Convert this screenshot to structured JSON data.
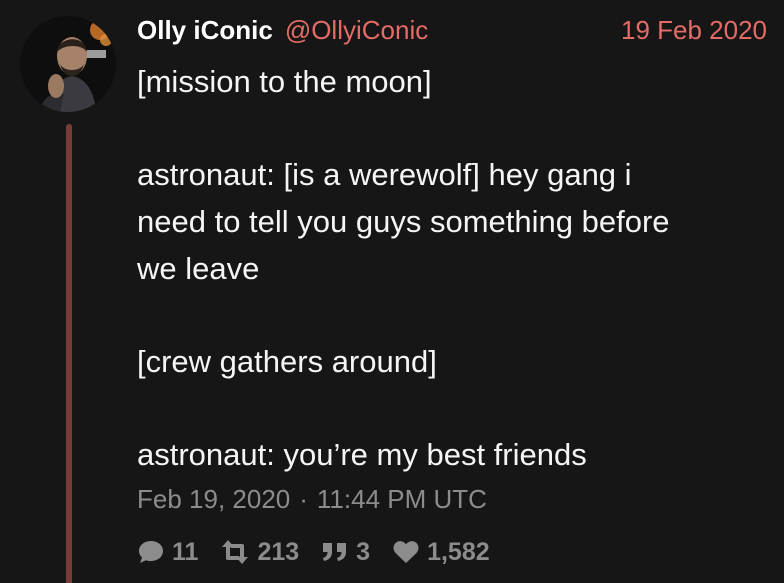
{
  "tweet": {
    "display_name": "Olly iConic",
    "handle": "@OllyiConic",
    "date": "19 Feb 2020",
    "lines": [
      "[mission to the moon]",
      "",
      "astronaut: [is a werewolf] hey gang i",
      "need to tell you guys something before",
      "we leave",
      "",
      "[crew gathers around]",
      "",
      "astronaut: you’re my best friends"
    ],
    "timestamp_date": "Feb 19, 2020",
    "timestamp_separator": "·",
    "timestamp_time": "11:44 PM UTC",
    "stats": {
      "replies": "11",
      "retweets": "213",
      "quotes": "3",
      "likes": "1,582"
    }
  },
  "icons": {
    "reply": "speech-bubble-icon",
    "retweet": "retweet-icon",
    "quote": "quote-icon",
    "like": "heart-icon"
  },
  "colors": {
    "background": "#161616",
    "accent": "#e36c66",
    "thread_line": "#7a3a38",
    "muted": "#8c8c8c"
  }
}
